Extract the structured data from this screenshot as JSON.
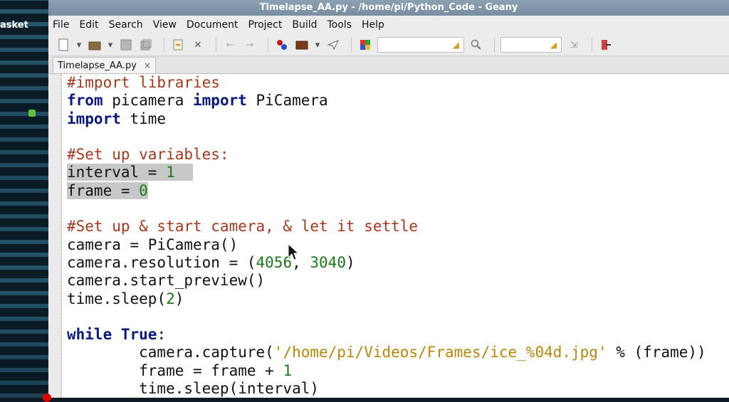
{
  "desktop": {
    "label": "asket"
  },
  "window": {
    "title": "Timelapse_AA.py - /home/pi/Python_Code - Geany"
  },
  "menu": [
    "File",
    "Edit",
    "Search",
    "View",
    "Document",
    "Project",
    "Build",
    "Tools",
    "Help"
  ],
  "toolbar": {
    "search_value": "",
    "goto_value": "",
    "icons": [
      "new-file-icon",
      "open-file-icon",
      "save-icon",
      "save-all-icon",
      "revert-icon",
      "close-icon",
      "back-icon",
      "forward-icon",
      "compile-icon",
      "build-icon",
      "run-icon",
      "color-chooser-icon",
      "find-icon",
      "jump-icon",
      "quit-icon"
    ]
  },
  "tabs": [
    {
      "label": "Timelapse_AA.py",
      "close": "×"
    }
  ],
  "code": {
    "l1_comment": "#import libraries",
    "l2_from": "from",
    "l2_mod": " picamera ",
    "l2_import": "import",
    "l2_name": " PiCamera",
    "l3_import": "import",
    "l3_name": " time",
    "l5_comment": "#Set up variables:",
    "l6_a": "interval = ",
    "l6_num": "1",
    "l7_a": "frame = ",
    "l7_num": "0",
    "l9_comment": "#Set up & start camera, & let it settle",
    "l10": "camera = PiCamera()",
    "l11_a": "camera.resolution = (",
    "l11_n1": "4056",
    "l11_b": ", ",
    "l11_n2": "3040",
    "l11_c": ")",
    "l12": "camera.start_preview()",
    "l13_a": "time.sleep(",
    "l13_num": "2",
    "l13_b": ")",
    "l15_while": "while",
    "l15_space": " ",
    "l15_true": "True",
    "l15_colon": ":",
    "l16_a": "        camera.capture(",
    "l16_str": "'/home/pi/Videos/Frames/ice_%04d.jpg'",
    "l16_b": " % (frame))",
    "l17_a": "        frame = frame + ",
    "l17_num": "1",
    "l18": "        time.sleep(interval)"
  },
  "colors": {
    "comment": "#a3381e",
    "keyword": "#0b1a7a",
    "number": "#1a7a1a",
    "string": "#b8860b"
  }
}
